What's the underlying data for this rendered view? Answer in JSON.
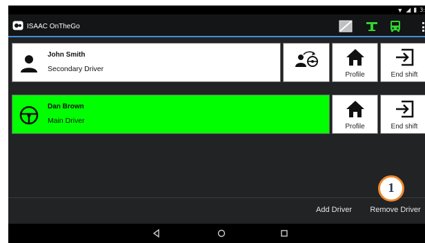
{
  "statusbar": {
    "time": "3:"
  },
  "appbar": {
    "title": "ISAAC OnTheGo"
  },
  "drivers": [
    {
      "name": "John Smith",
      "role": "Secondary Driver",
      "profile_label": "Profile",
      "end_shift_label": "End shift"
    },
    {
      "name": "Dan Brown",
      "role": "Main Driver",
      "profile_label": "Profile",
      "end_shift_label": "End shift"
    }
  ],
  "footer": {
    "add_driver": "Add Driver",
    "remove_driver": "Remove Driver"
  },
  "callout": {
    "number": "1"
  },
  "colors": {
    "main_driver_bg": "#00ff00",
    "appbar_accent": "#3f8fe0",
    "callout_border": "#f0892e",
    "toolbar_green": "#2fd52f"
  },
  "icons": [
    "person-icon",
    "switch-driver-icon",
    "home-icon",
    "exit-icon",
    "steering-wheel-icon",
    "signal-icon",
    "bus-icon",
    "tachograph-icon"
  ]
}
